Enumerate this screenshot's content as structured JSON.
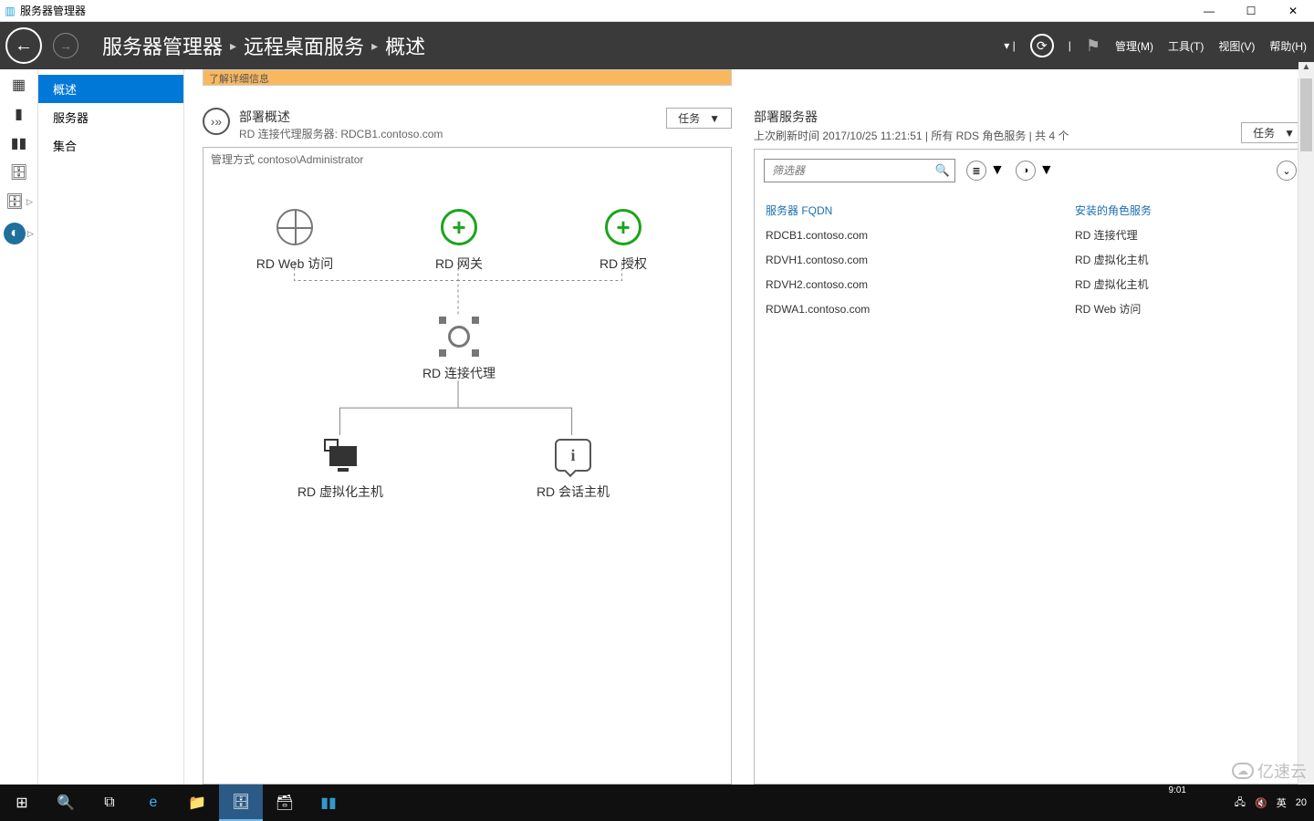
{
  "window": {
    "title": "服务器管理器"
  },
  "breadcrumb": {
    "a": "服务器管理器",
    "b": "远程桌面服务",
    "c": "概述"
  },
  "menu": {
    "manage": "管理(M)",
    "tools": "工具(T)",
    "view": "视图(V)",
    "help": "帮助(H)"
  },
  "nav": {
    "items": [
      "概述",
      "服务器",
      "集合"
    ],
    "selected": 0
  },
  "banner": {
    "text": "了解详细信息"
  },
  "deploy_overview": {
    "title": "部署概述",
    "subtitle_prefix": "RD 连接代理服务器: ",
    "broker_server": "RDCB1.contoso.com",
    "tasks_label": "任务",
    "managed_prefix": "管理方式 ",
    "managed_user": "contoso\\Administrator",
    "nodes": {
      "web": "RD Web 访问",
      "gateway": "RD 网关",
      "licensing": "RD 授权",
      "broker": "RD 连接代理",
      "vhost": "RD 虚拟化主机",
      "shost": "RD 会话主机"
    }
  },
  "deploy_servers": {
    "title": "部署服务器",
    "refresh_prefix": "上次刷新时间 ",
    "refresh_time": "2017/10/25 11:21:51",
    "summary": " | 所有 RDS 角色服务  | 共 4 个",
    "tasks_label": "任务",
    "filter_placeholder": "筛选器",
    "col_fqdn": "服务器 FQDN",
    "col_role": "安装的角色服务",
    "rows": [
      {
        "fqdn": "RDCB1.contoso.com",
        "role": "RD 连接代理"
      },
      {
        "fqdn": "RDVH1.contoso.com",
        "role": "RD 虚拟化主机"
      },
      {
        "fqdn": "RDVH2.contoso.com",
        "role": "RD 虚拟化主机"
      },
      {
        "fqdn": "RDWA1.contoso.com",
        "role": "RD Web 访问"
      }
    ]
  },
  "tray": {
    "ime": "英",
    "time": "9:01",
    "timecut": "20"
  },
  "watermark": "亿速云"
}
